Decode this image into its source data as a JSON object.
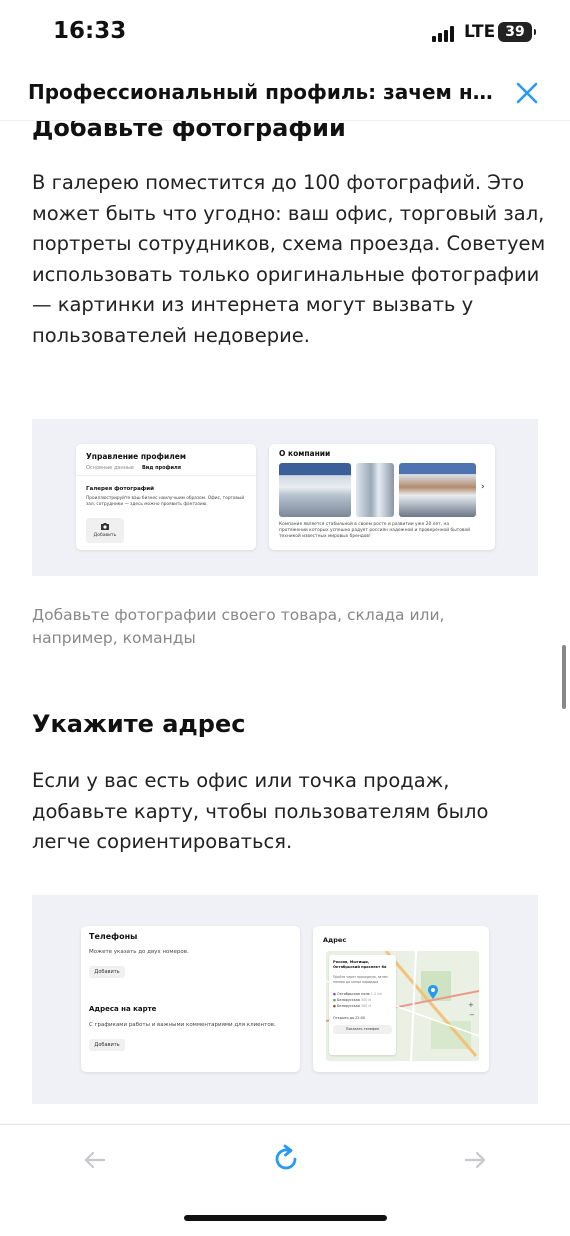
{
  "status_bar": {
    "time": "16:33",
    "network": "LTE",
    "battery": "39"
  },
  "header": {
    "title": "Профессиональный профиль: зачем ну..."
  },
  "sections": [
    {
      "heading": "Добавьте фотографии",
      "text": "В галерею поместится до 100 фотографий. Это может быть что угодно: ваш офис, торговый зал, портреты сотрудников, схема проезда. Советуем использовать только оригинальные фотографии — картинки из интернета могут вызвать у пользователей недоверие.",
      "caption": "Добавьте фотографии своего товара, склада или, например, команды"
    },
    {
      "heading": "Укажите адрес",
      "text": "Если у вас есть офис или точка продаж, добавьте карту, чтобы пользователям было легче сориентироваться."
    }
  ],
  "illustration_gallery": {
    "profile_card": {
      "title": "Управление профилем",
      "tab_basic": "Основные данные",
      "tab_view": "Вид профиля",
      "gallery_title": "Галерея фотографий",
      "gallery_desc": "Проиллюстрируйте ваш бизнес наилучшим образом. Офис, торговый зал, сотрудники — здесь можно проявить фантазию.",
      "add_label": "Добавить"
    },
    "company_card": {
      "title": "О компании",
      "text": "Компания является стабильной в своем росте и развитии уже 20 лет, на протяжении которых успешно радует россиян надежной и проверенной бытовой техникой известных мировых брендов!",
      "next": "›"
    }
  },
  "illustration_address": {
    "contacts_card": {
      "phones_title": "Телефоны",
      "phones_desc": "Можете указать до двух номеров.",
      "phones_add": "Добавить",
      "map_title": "Адреса на карте",
      "map_desc": "С графиками работы и важными комментариями для клиентов.",
      "map_add": "Добавить"
    },
    "address_card": {
      "title": "Адрес",
      "address": "Россия, Мытищи, Октябрьский проспект 6а",
      "directions": "Пройти через проходную, затем налево до конца коридора",
      "metro": [
        {
          "name": "Октябрьское поле",
          "dist": "1.2 км",
          "color": "#8e44ad"
        },
        {
          "name": "Белорусская",
          "dist": "300 м",
          "color": "#4caf50"
        },
        {
          "name": "Белорусская",
          "dist": "300 м",
          "color": "#795548"
        }
      ],
      "hours": "Открыто до 22:00",
      "show_phone": "Показать телефон"
    }
  },
  "colors": {
    "accent": "#2a9af0",
    "caption": "#888888",
    "illustration_bg": "#f0f1f6"
  }
}
